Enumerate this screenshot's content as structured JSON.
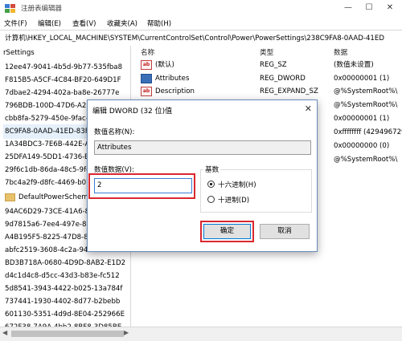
{
  "window": {
    "title": "注册表编辑器",
    "minimize_icon": "minimize-icon",
    "maximize_icon": "maximize-icon",
    "close_icon": "close-icon"
  },
  "menu": {
    "items": [
      "文件(F)",
      "编辑(E)",
      "查看(V)",
      "收藏夹(A)",
      "帮助(H)"
    ]
  },
  "address": {
    "path": "计算机\\HKEY_LOCAL_MACHINE\\SYSTEM\\CurrentControlSet\\Control\\Power\\PowerSettings\\238C9FA8-0AAD-41ED"
  },
  "tree": {
    "header": "rSettings",
    "items": [
      "12ee47-9041-4b5d-9b77-535fba8",
      "F815B5-A5CF-4C84-BF20-649D1F",
      "7dbae2-4294-402a-ba8e-26777e",
      "796BDB-100D-47D6-A2D5-F7D2D",
      "cbb8fa-5279-450e-9fac-8a3d5fe",
      "8C9FA8-0AAD-41ED-83F4-97BE242",
      "1A34BDC3-7E6B-442E-A4E1-...",
      "25DFA149-5DD1-4736-B5AB-E8A3",
      "29f6c1db-86da-48c5-9fdb-f2b67",
      "7bc4a2f9-d8fc-4469-b07b-33eb7",
      "DefaultPowerSchemeValues",
      "94AC6D29-73CE-41A6-809F-6363",
      "9d7815a6-7ee4-497e-8888-515a0",
      "A4B195F5-8225-47D8-8012-9D41",
      "abfc2519-3608-4c2a-94ea-171b0",
      "BD3B718A-0680-4D9D-8AB2-E1D2",
      "d4c1d4c8-d5cc-43d3-b83e-fc512",
      "5d8541-3943-4422-b025-13a784f",
      "737441-1930-4402-8d77-b2bebb",
      "601130-5351-4d9d-8E04-252966E",
      "672F38-7A9A-4bb2-8BF8-3D85BE",
      "71e89-eebd-4455-a8de-9e59040"
    ]
  },
  "list": {
    "columns": {
      "name": "名称",
      "type": "类型",
      "data": "数据"
    },
    "rows": [
      {
        "icon": "string-value-icon",
        "name": "(默认)",
        "type": "REG_SZ",
        "data": "(数值未设置)"
      },
      {
        "icon": "binary-value-icon",
        "name": "Attributes",
        "type": "REG_DWORD",
        "data": "0x00000001 (1)"
      },
      {
        "icon": "string-value-icon",
        "name": "Description",
        "type": "REG_EXPAND_SZ",
        "data": "@%SystemRoot%\\"
      },
      {
        "icon": "",
        "name": "",
        "type": "",
        "data": "@%SystemRoot%\\"
      },
      {
        "icon": "",
        "name": "",
        "type": "",
        "data": "0x00000001 (1)"
      },
      {
        "icon": "",
        "name": "",
        "type": "",
        "data": "0xffffffff (429496729"
      },
      {
        "icon": "",
        "name": "",
        "type": "",
        "data": "0x00000000 (0)"
      },
      {
        "icon": "",
        "name": "",
        "type": "",
        "data": "@%SystemRoot%\\"
      }
    ]
  },
  "dialog": {
    "title": "编辑 DWORD (32 位)值",
    "name_label": "数值名称(N):",
    "name_value": "Attributes",
    "data_label": "数值数据(V):",
    "data_value": "2",
    "base_label": "基数",
    "hex_label": "十六进制(H)",
    "dec_label": "十进制(D)",
    "ok_label": "确定",
    "cancel_label": "取消",
    "close_icon": "close-icon"
  },
  "colors": {
    "highlight": "#d9272e",
    "accent": "#0078d7",
    "selection": "#e5f0fb"
  }
}
